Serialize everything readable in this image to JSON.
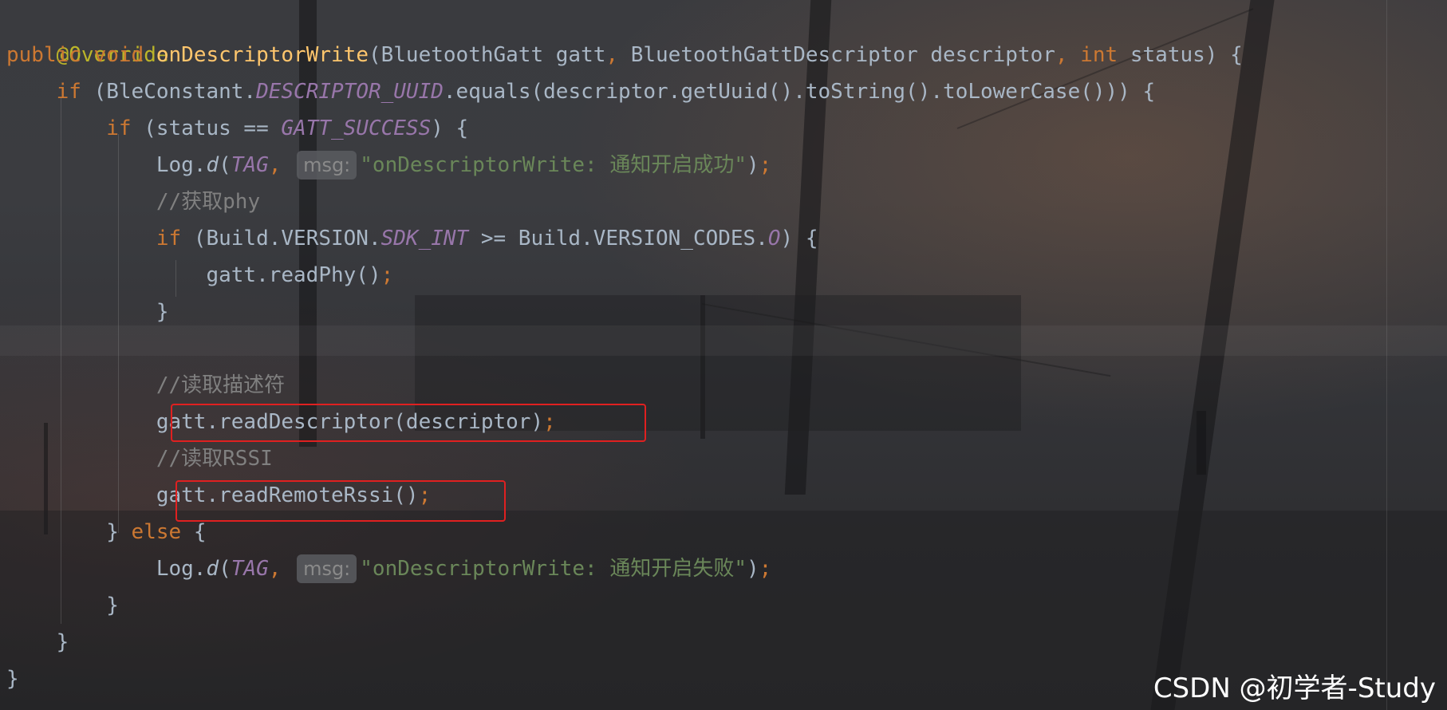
{
  "code": {
    "line1": {
      "annotation": "@Override"
    },
    "line2": {
      "kw_public": "public",
      "kw_void": "void",
      "method": "onDescriptorWrite",
      "p1": "(BluetoothGatt gatt",
      "c1": ",",
      "p2": " BluetoothGattDescriptor descriptor",
      "c2": ",",
      "kw_int": "int",
      "p3": " status) {"
    },
    "line3": {
      "kw_if": "if",
      "p1": " (BleConstant.",
      "const": "DESCRIPTOR_UUID",
      "p2": ".equals(descriptor.getUuid().toString().toLowerCase())) {"
    },
    "line4": {
      "kw_if": "if",
      "p1": " (status == ",
      "const": "GATT_SUCCESS",
      "p2": ") {"
    },
    "line5": {
      "p1": "Log.",
      "fn": "d",
      "p2": "(",
      "const": "TAG",
      "comma": ",",
      "hint": "msg:",
      "str": "\"onDescriptorWrite: 通知开启成功\"",
      "p3": ")",
      "semi": ";"
    },
    "line6": {
      "comment": "//获取phy"
    },
    "line7": {
      "kw_if": "if",
      "p1": " (Build.VERSION.",
      "const1": "SDK_INT",
      "p2": " >= Build.VERSION_CODES.",
      "const2": "O",
      "p3": ") {"
    },
    "line8": {
      "p1": "gatt.readPhy()",
      "semi": ";"
    },
    "line9": {
      "p1": "}"
    },
    "line11": {
      "comment": "//读取描述符"
    },
    "line12": {
      "p1": "gatt.readDescriptor(descriptor)",
      "semi": ";"
    },
    "line13": {
      "comment": "//读取RSSI"
    },
    "line14": {
      "p1": "gatt.readRemoteRssi()",
      "semi": ";"
    },
    "line15": {
      "p1": "} ",
      "kw_else": "else",
      "p2": " {"
    },
    "line16": {
      "p1": "Log.",
      "fn": "d",
      "p2": "(",
      "const": "TAG",
      "comma": ",",
      "hint": "msg:",
      "str": "\"onDescriptorWrite: 通知开启失败\"",
      "p3": ")",
      "semi": ";"
    },
    "line17": {
      "p1": "}"
    },
    "line18": {
      "p1": "}"
    },
    "line19": {
      "p1": "}"
    }
  },
  "watermark": "CSDN @初学者-Study",
  "colors": {
    "background": "#2f3033",
    "keyword": "#cc7832",
    "method": "#ffc66d",
    "constant": "#9876aa",
    "string": "#6a8759",
    "comment": "#808080",
    "text": "#a9b7c6",
    "annotation": "#bbb529",
    "highlight_box": "#e02020"
  }
}
